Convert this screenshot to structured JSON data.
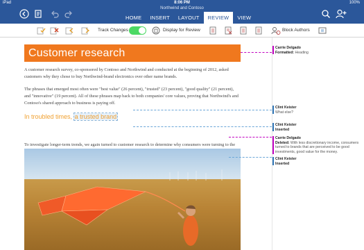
{
  "status": {
    "carrier": "iPad",
    "time": "8:06 PM",
    "battery": "100%"
  },
  "doc_title": "Northwind and Contoso",
  "tabs": [
    {
      "label": "HOME"
    },
    {
      "label": "INSERT"
    },
    {
      "label": "LAYOUT"
    },
    {
      "label": "REVIEW"
    },
    {
      "label": "VIEW"
    }
  ],
  "active_tab": "REVIEW",
  "ribbon": {
    "track_changes_label": "Track Changes",
    "track_changes_on": true,
    "display_label": "Display for Review",
    "block_authors_label": "Block Authors"
  },
  "document": {
    "heading": "Customer research",
    "p1": "A customer research survey, co-sponsored by Contoso and Northwind and conducted at the beginning of 2012, asked customers why they chose to buy Northwind-brand electronics over other name brands.",
    "p2": "The phrases that emerged most often were \"best value\" (26 percent), \"trusted\" (23 percent), \"good quality\" (21 percent), and \"innovative\" (19 percent). All of these phrases map back to both companies' core values, proving that Northwind's and Contoso's shared approach to business is paying off.",
    "h2_text": "In troubled times,",
    "h2_inserted": "a trusted brand",
    "p3": "To investigate longer-term trends, we again turned to customer research to determine why consumers were turning to the Northwind brand in droves. Not surprisingly, the worldwide recession that began in 2008 has been a major factor."
  },
  "markup": [
    {
      "author": "Carrie Delgado",
      "action": "Formatted:",
      "detail": "Heading",
      "color": "#c000c0"
    },
    {
      "author": "Clint Keister",
      "action": "",
      "detail": "What else?",
      "color": "#2e75b6"
    },
    {
      "author": "Clint Keister",
      "action": "Inserted",
      "detail": "",
      "color": "#2e75b6"
    },
    {
      "author": "Carrie Delgado",
      "action": "Deleted:",
      "detail": "With less discretionary income, consumers turned to brands that are perceived to be good investments, good value for the money.",
      "color": "#c000c0"
    },
    {
      "author": "Clint Keister",
      "action": "Inserted",
      "detail": "",
      "color": "#2e75b6"
    }
  ],
  "colors": {
    "titlebar": "#2b579a",
    "heading_fill": "#f0781e",
    "heading2": "#f0a030",
    "toggle_on": "#4cd964"
  }
}
